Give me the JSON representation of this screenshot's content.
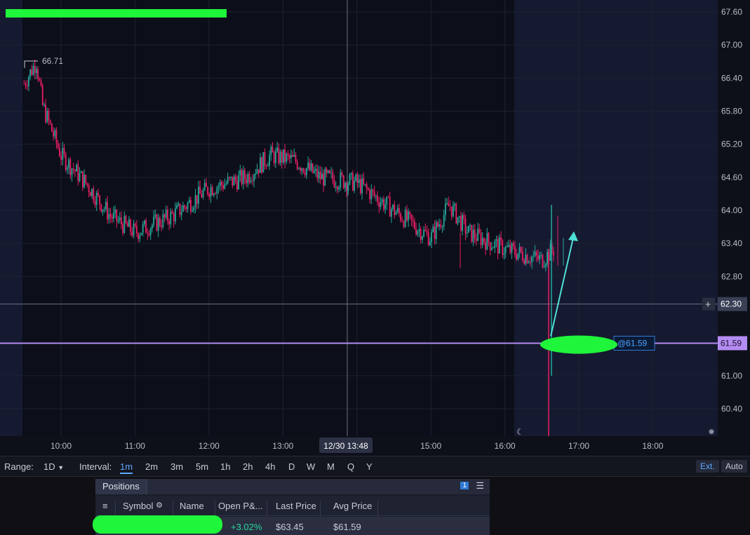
{
  "chart": {
    "redacted_title": "",
    "high_marker": "66.71",
    "crosshair_time": "12/30 13:48",
    "crosshair_price": "62.30",
    "order_line_price": "61.59",
    "order_label": "@61.59",
    "colors": {
      "up": "#26a69a",
      "down": "#e91e63",
      "order": "#b48cf2",
      "arrow": "#4fe0d6",
      "bg": "#0c0e19",
      "extended_bg": "#161a30"
    },
    "icons": [
      "plus-icon",
      "moon-icon",
      "sun-icon",
      "arrow-icon"
    ]
  },
  "chart_data": {
    "type": "candlestick",
    "ylim": [
      60.0,
      67.8
    ],
    "y_ticks": [
      "67.60",
      "67.00",
      "66.40",
      "65.80",
      "65.20",
      "64.60",
      "64.00",
      "63.40",
      "62.80",
      "62.30",
      "61.59",
      "61.00",
      "60.40"
    ],
    "x_ticks": [
      "10:00",
      "11:00",
      "12:00",
      "13:00",
      "14:00",
      "15:00",
      "16:00",
      "17:00",
      "18:00"
    ],
    "trend_points": [
      {
        "x": "09:30",
        "y": 66.3
      },
      {
        "x": "09:40",
        "y": 66.7
      },
      {
        "x": "09:45",
        "y": 65.9
      },
      {
        "x": "10:00",
        "y": 65.0
      },
      {
        "x": "10:20",
        "y": 64.5
      },
      {
        "x": "10:40",
        "y": 63.9
      },
      {
        "x": "11:00",
        "y": 63.6
      },
      {
        "x": "11:30",
        "y": 63.9
      },
      {
        "x": "12:00",
        "y": 64.4
      },
      {
        "x": "12:30",
        "y": 64.6
      },
      {
        "x": "12:50",
        "y": 65.0
      },
      {
        "x": "13:10",
        "y": 64.9
      },
      {
        "x": "13:30",
        "y": 64.6
      },
      {
        "x": "14:00",
        "y": 64.5
      },
      {
        "x": "14:30",
        "y": 64.0
      },
      {
        "x": "15:00",
        "y": 63.5
      },
      {
        "x": "15:15",
        "y": 64.1
      },
      {
        "x": "15:30",
        "y": 63.6
      },
      {
        "x": "16:00",
        "y": 63.3
      },
      {
        "x": "16:30",
        "y": 63.1
      },
      {
        "x": "16:40",
        "y": 63.3
      }
    ]
  },
  "toolbar": {
    "range_label": "Range:",
    "range_value": "1D",
    "interval_label": "Interval:",
    "intervals": [
      "1m",
      "2m",
      "3m",
      "5m",
      "1h",
      "2h",
      "4h",
      "D",
      "W",
      "M",
      "Q",
      "Y"
    ],
    "active_interval": "1m",
    "ext_label": "Ext.",
    "auto_label": "Auto"
  },
  "positions": {
    "title": "Positions",
    "badge": "1",
    "columns": [
      "Symbol",
      "Name",
      "Open P&...",
      "Last Price",
      "Avg Price"
    ],
    "row": {
      "open_pl": "+3.02%",
      "last_price": "$63.45",
      "avg_price": "$61.59"
    }
  }
}
